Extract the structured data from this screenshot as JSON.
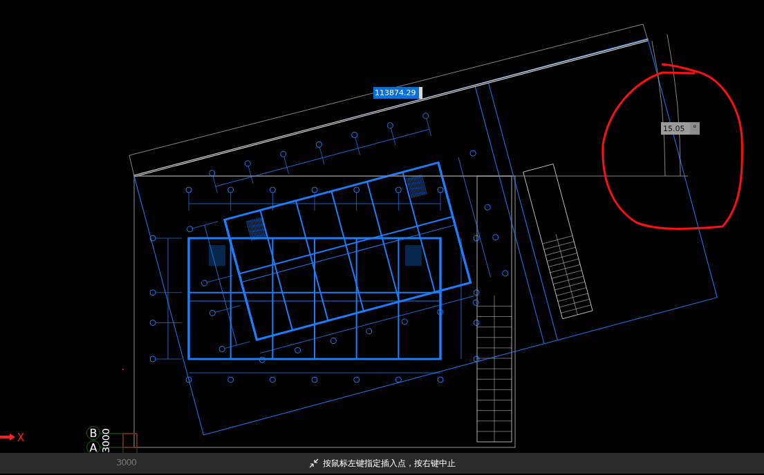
{
  "dimension_input": {
    "value": "113874.29"
  },
  "angle_input": {
    "value": "15.05",
    "unit": "°"
  },
  "ucs": {
    "x_label": "X"
  },
  "grid_axes": [
    {
      "label": "B"
    },
    {
      "label": "A"
    }
  ],
  "grid_spacing": "3000",
  "bottom_axes_label": "3000",
  "status_bar": {
    "prompt": "按鼠标左键指定插入点，按右键中止"
  }
}
